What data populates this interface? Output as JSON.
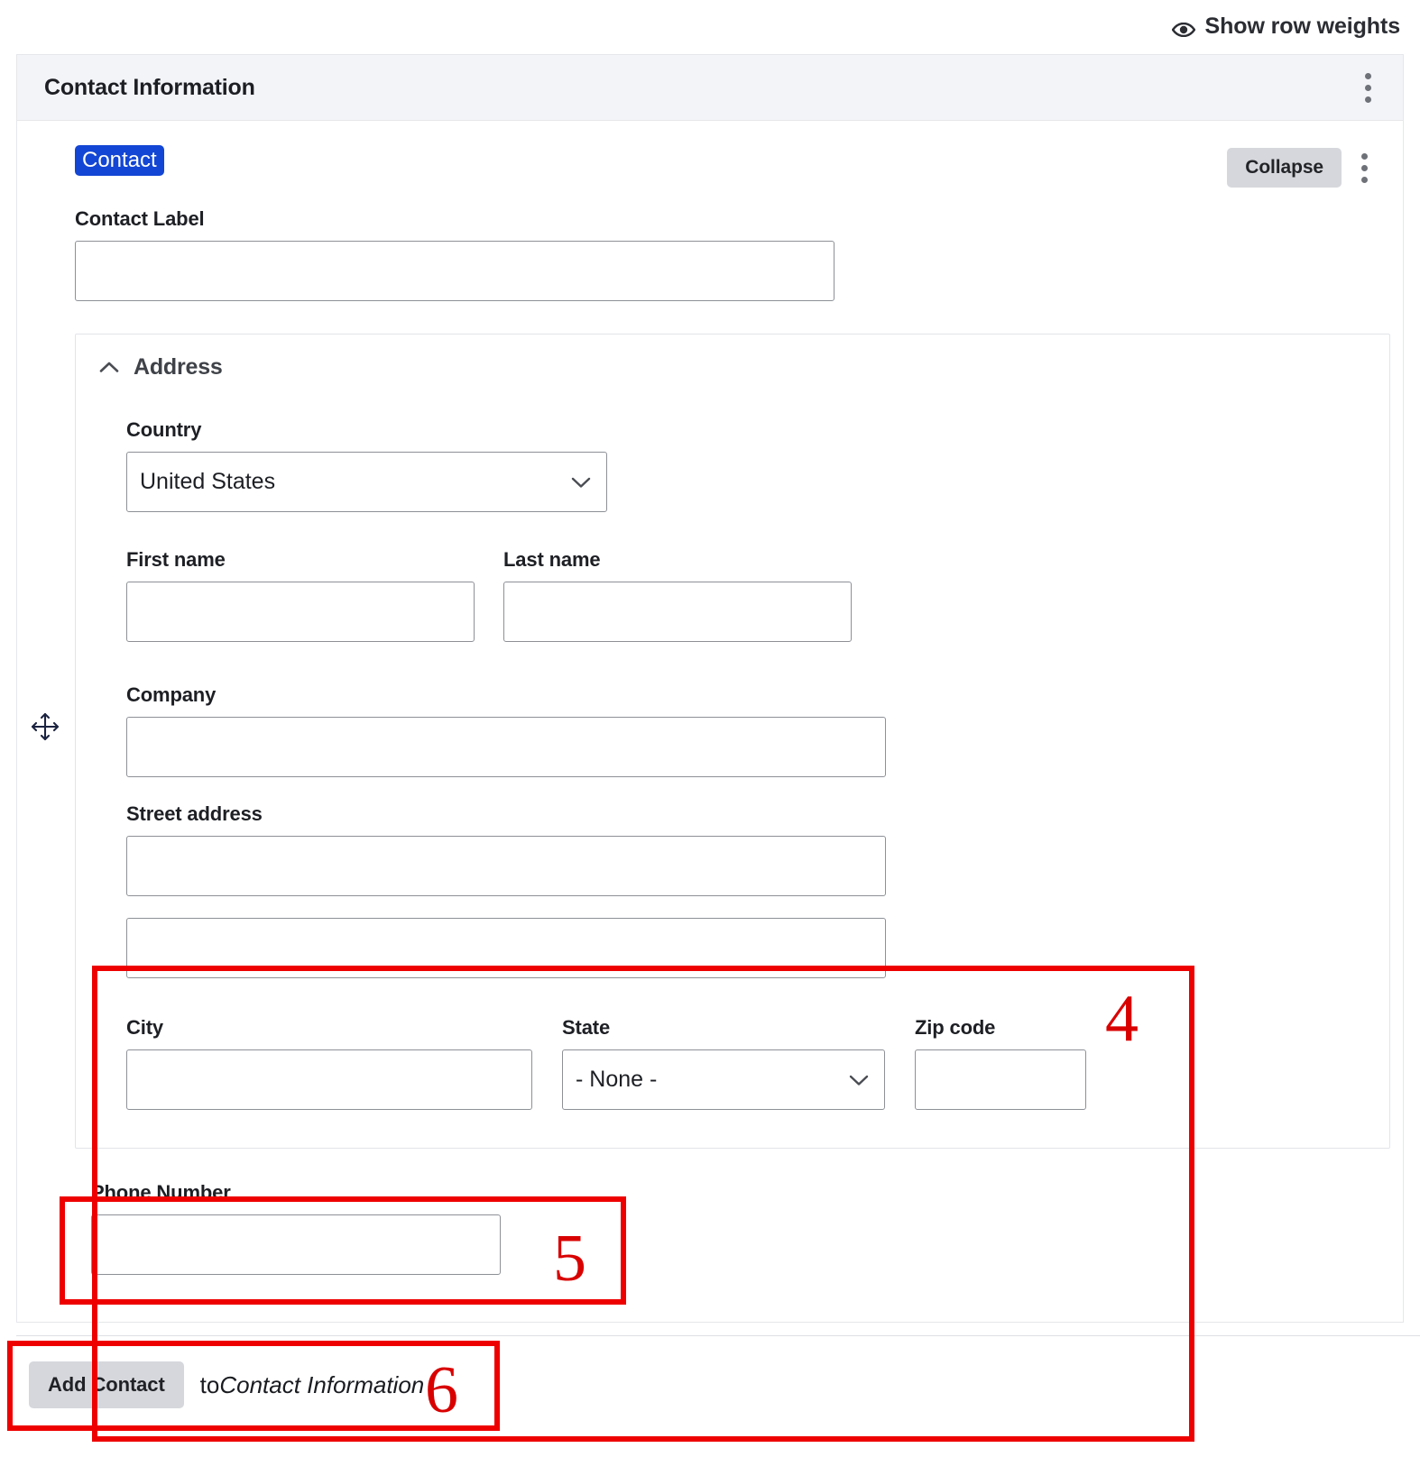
{
  "top_bar": {
    "show_row_weights_label": "Show row weights",
    "eye_icon": "eye-icon"
  },
  "panel": {
    "title": "Contact Information",
    "menu_icon": "kebab-menu-icon"
  },
  "row": {
    "badge_label": "Contact",
    "collapse_label": "Collapse",
    "row_menu_icon": "kebab-menu-icon",
    "drag_icon": "move-arrows-icon"
  },
  "contact_label": {
    "label": "Contact Label",
    "value": "",
    "placeholder": ""
  },
  "address": {
    "title": "Address",
    "toggle_icon": "chevron-up-icon",
    "country": {
      "label": "Country",
      "value": "United States",
      "chevron_icon": "chevron-down-icon"
    },
    "first_name": {
      "label": "First name",
      "value": "",
      "placeholder": ""
    },
    "last_name": {
      "label": "Last name",
      "value": "",
      "placeholder": ""
    },
    "company": {
      "label": "Company",
      "value": "",
      "placeholder": ""
    },
    "street": {
      "label": "Street address",
      "line1": "",
      "line2": "",
      "placeholder": ""
    },
    "city": {
      "label": "City",
      "value": "",
      "placeholder": ""
    },
    "state": {
      "label": "State",
      "value": "- None -",
      "chevron_icon": "chevron-down-icon"
    },
    "zip": {
      "label": "Zip code",
      "value": "",
      "placeholder": ""
    }
  },
  "phone": {
    "label": "Phone Number",
    "value": "",
    "placeholder": ""
  },
  "footer": {
    "add_button_label": "Add Contact",
    "to_text": "to",
    "target_text": "Contact Information"
  },
  "annotations": {
    "box4": "4",
    "box5": "5",
    "box6": "6",
    "color": "#ee0000"
  },
  "colors": {
    "badge_blue": "#1346d4",
    "header_bg": "#f3f4f8",
    "button_gray": "#d6d7dc",
    "annotation_red": "#ee0000"
  }
}
